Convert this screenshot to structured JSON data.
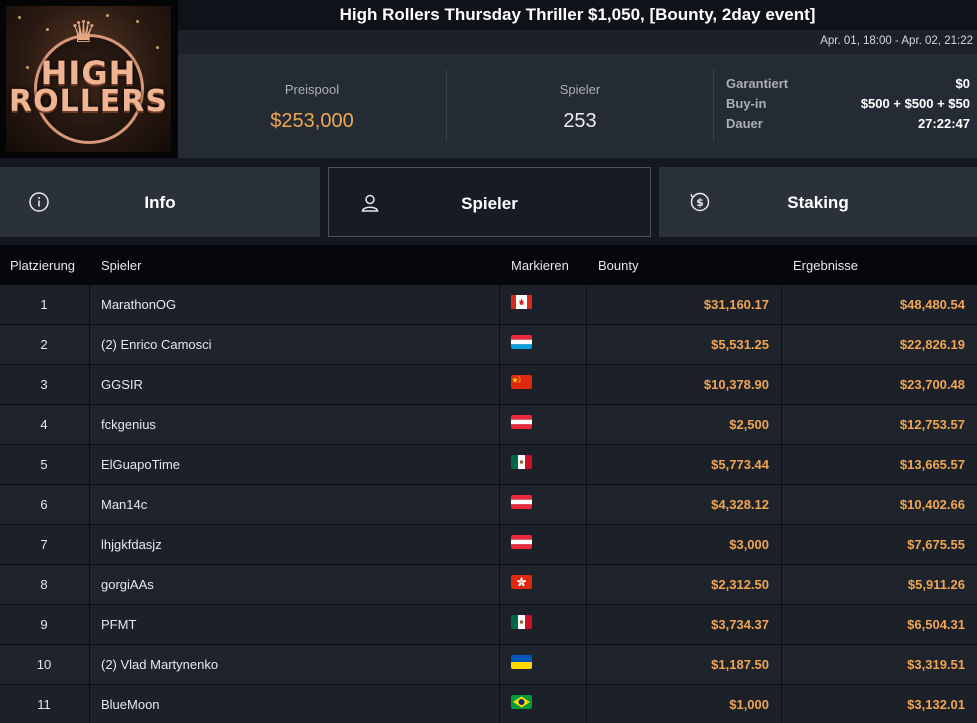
{
  "logo": {
    "line1": "HIGH",
    "line2": "ROLLERS"
  },
  "header": {
    "title": "High Rollers Thursday Thriller $1,050, [Bounty, 2day event]",
    "date_range": "Apr. 01, 18:00 - Apr. 02, 21:22"
  },
  "stats": {
    "prize_pool_label": "Preispool",
    "prize_pool_value": "$253,000",
    "players_label": "Spieler",
    "players_value": "253",
    "details": [
      {
        "label": "Garantiert",
        "value": "$0"
      },
      {
        "label": "Buy-in",
        "value": "$500 + $500 + $50"
      },
      {
        "label": "Dauer",
        "value": "27:22:47"
      }
    ]
  },
  "tabs": [
    {
      "label": "Info",
      "icon": "info-icon",
      "active": false
    },
    {
      "label": "Spieler",
      "icon": "user-icon",
      "active": true
    },
    {
      "label": "Staking",
      "icon": "dollar-coin-icon",
      "active": false
    }
  ],
  "table": {
    "headers": {
      "rank": "Platzierung",
      "player": "Spieler",
      "flag": "Markieren",
      "bounty": "Bounty",
      "result": "Ergebnisse"
    },
    "rows": [
      {
        "rank": "1",
        "player": "MarathonOG",
        "flag": "canada",
        "bounty": "$31,160.17",
        "result": "$48,480.54"
      },
      {
        "rank": "2",
        "player": "(2) Enrico Camosci",
        "flag": "luxembourg",
        "bounty": "$5,531.25",
        "result": "$22,826.19"
      },
      {
        "rank": "3",
        "player": "GGSIR",
        "flag": "china",
        "bounty": "$10,378.90",
        "result": "$23,700.48"
      },
      {
        "rank": "4",
        "player": "fckgenius",
        "flag": "austria",
        "bounty": "$2,500",
        "result": "$12,753.57"
      },
      {
        "rank": "5",
        "player": "ElGuapoTime",
        "flag": "mexico",
        "bounty": "$5,773.44",
        "result": "$13,665.57"
      },
      {
        "rank": "6",
        "player": "Man14c",
        "flag": "austria",
        "bounty": "$4,328.12",
        "result": "$10,402.66"
      },
      {
        "rank": "7",
        "player": "lhjgkfdasjz",
        "flag": "austria",
        "bounty": "$3,000",
        "result": "$7,675.55"
      },
      {
        "rank": "8",
        "player": "gorgiAAs",
        "flag": "hong-kong",
        "bounty": "$2,312.50",
        "result": "$5,911.26"
      },
      {
        "rank": "9",
        "player": "PFMT",
        "flag": "mexico",
        "bounty": "$3,734.37",
        "result": "$6,504.31"
      },
      {
        "rank": "10",
        "player": "(2) Vlad Martynenko",
        "flag": "ukraine",
        "bounty": "$1,187.50",
        "result": "$3,319.51"
      },
      {
        "rank": "11",
        "player": "BlueMoon",
        "flag": "brazil",
        "bounty": "$1,000",
        "result": "$3,132.01"
      }
    ]
  },
  "colors": {
    "accent": "#f0a651",
    "background": "#0e1116",
    "panel": "#252b35"
  }
}
